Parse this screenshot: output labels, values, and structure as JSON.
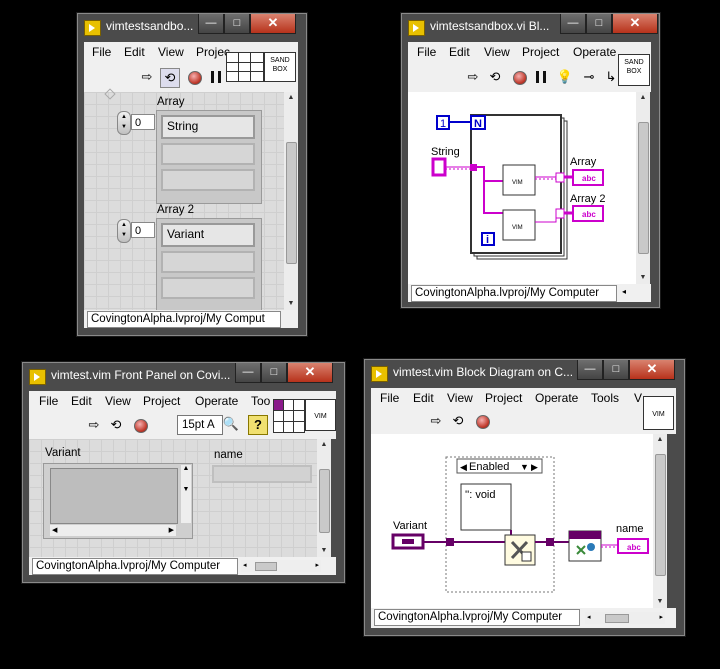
{
  "menu": {
    "file": "File",
    "edit": "Edit",
    "view": "View",
    "project": "Project",
    "projec_trunc": "Projec",
    "operate": "Operate",
    "operat_trunc": "Operate",
    "tools": "Tools",
    "tools_trunc": "Too",
    "v_trunc": "V"
  },
  "icons": {
    "run": "run-arrow-icon",
    "run_cont": "run-continuously-icon",
    "abort": "abort-icon",
    "pause": "pause-icon",
    "highlight": "highlight-execution-icon",
    "help": "context-help-icon"
  },
  "win1": {
    "title": "vimtestsandbo...",
    "icon_text": "SAND BOX",
    "array_label": "Array",
    "array_index": "0",
    "array_value": "String",
    "array2_label": "Array 2",
    "array2_index": "0",
    "array2_value": "Variant",
    "status": "CovingtonAlpha.lvproj/My Comput"
  },
  "win2": {
    "title": "vimtestsandbox.vi Bl...",
    "icon_text": "SAND BOX",
    "const_one": "1",
    "n_label": "N",
    "i_label": "i",
    "string_label": "String",
    "vim1": "VIM",
    "vim2": "VIM",
    "array_label": "Array",
    "array2_label": "Array 2",
    "abc": "abc",
    "status": "CovingtonAlpha.lvproj/My Computer"
  },
  "win3": {
    "title": "vimtest.vim Front Panel on Covi...",
    "icon_text": "VIM",
    "font_value": "15pt A",
    "variant_label": "Variant",
    "name_label": "name",
    "status": "CovingtonAlpha.lvproj/My Computer"
  },
  "win4": {
    "title": "vimtest.vim Block Diagram on C...",
    "icon_text": "VIM",
    "case_selector": "Enabled",
    "void_text": "'': void",
    "variant_label": "Variant",
    "name_label": "name",
    "abc": "abc",
    "status": "CovingtonAlpha.lvproj/My Computer"
  },
  "colors": {
    "wire_pink": "#cc00cc",
    "wire_blue": "#0000cc",
    "variant_purple": "#660066",
    "title_bar": "#4b4b4b"
  }
}
